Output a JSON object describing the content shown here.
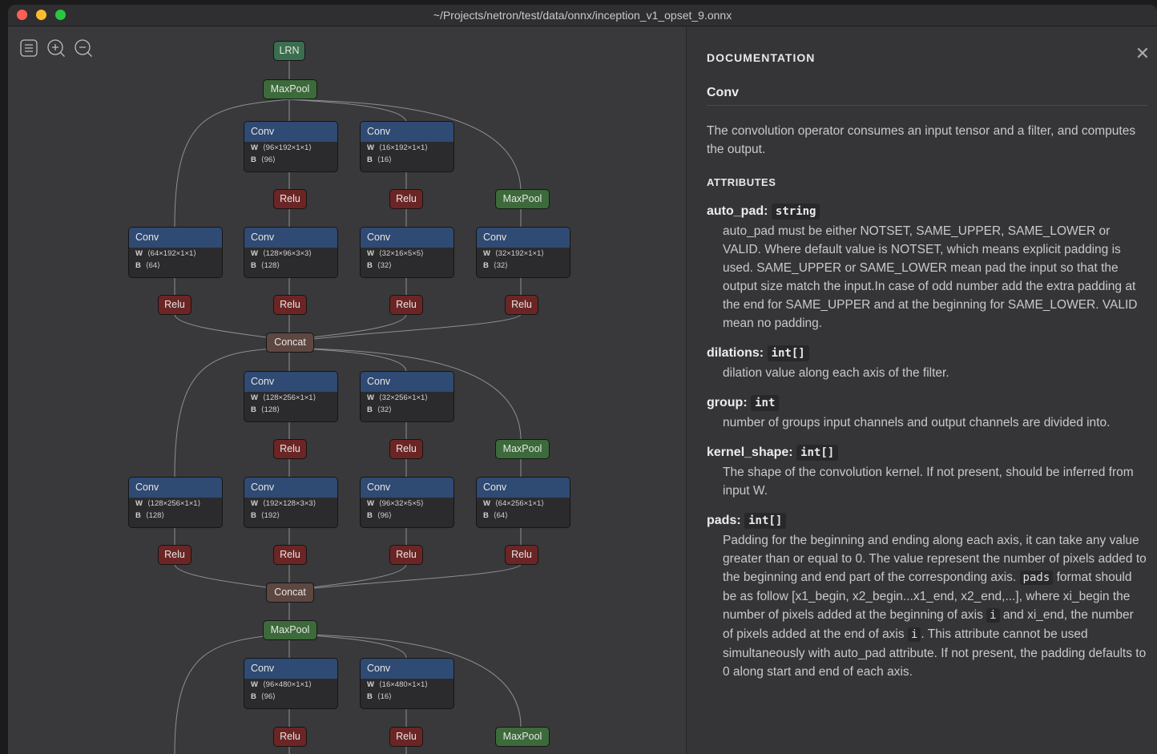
{
  "window": {
    "title": "~/Projects/netron/test/data/onnx/inception_v1_opset_9.onnx"
  },
  "toolbar": {
    "buttons": [
      "sidebar-icon",
      "zoom-in-icon",
      "zoom-out-icon"
    ]
  },
  "graph": {
    "ops": {
      "lrn": "LRN",
      "maxpool": "MaxPool",
      "conv": "Conv",
      "relu": "Relu",
      "concat": "Concat"
    },
    "convs": [
      {
        "w": "⟨96×192×1×1⟩",
        "b": "⟨96⟩"
      },
      {
        "w": "⟨16×192×1×1⟩",
        "b": "⟨16⟩"
      },
      {
        "w": "⟨64×192×1×1⟩",
        "b": "⟨64⟩"
      },
      {
        "w": "⟨128×96×3×3⟩",
        "b": "⟨128⟩"
      },
      {
        "w": "⟨32×16×5×5⟩",
        "b": "⟨32⟩"
      },
      {
        "w": "⟨32×192×1×1⟩",
        "b": "⟨32⟩"
      },
      {
        "w": "⟨128×256×1×1⟩",
        "b": "⟨128⟩"
      },
      {
        "w": "⟨32×256×1×1⟩",
        "b": "⟨32⟩"
      },
      {
        "w": "⟨128×256×1×1⟩",
        "b": "⟨128⟩"
      },
      {
        "w": "⟨192×128×3×3⟩",
        "b": "⟨192⟩"
      },
      {
        "w": "⟨96×32×5×5⟩",
        "b": "⟨96⟩"
      },
      {
        "w": "⟨64×256×1×1⟩",
        "b": "⟨64⟩"
      },
      {
        "w": "⟨96×480×1×1⟩",
        "b": "⟨96⟩"
      },
      {
        "w": "⟨16×480×1×1⟩",
        "b": "⟨16⟩"
      }
    ],
    "conv_labels": {
      "w": "W",
      "b": "B"
    }
  },
  "doc": {
    "title": "DOCUMENTATION",
    "close": "✕",
    "op_name": "Conv",
    "summary": "The convolution operator consumes an input tensor and a filter, and computes the output.",
    "attributes_heading": "ATTRIBUTES",
    "attributes": [
      {
        "name": "auto_pad:",
        "type": "string",
        "desc": "auto_pad must be either NOTSET, SAME_UPPER, SAME_LOWER or VALID. Where default value is NOTSET, which means explicit padding is used. SAME_UPPER or SAME_LOWER mean pad the input so that the output size match the input.In case of odd number add the extra padding at the end for SAME_UPPER and at the beginning for SAME_LOWER. VALID mean no padding."
      },
      {
        "name": "dilations:",
        "type": "int[]",
        "desc": "dilation value along each axis of the filter."
      },
      {
        "name": "group:",
        "type": "int",
        "desc": "number of groups input channels and output channels are divided into."
      },
      {
        "name": "kernel_shape:",
        "type": "int[]",
        "desc": "The shape of the convolution kernel. If not present, should be inferred from input W."
      },
      {
        "name": "pads:",
        "type": "int[]",
        "desc_1": "Padding for the beginning and ending along each axis, it can take any value greater than or equal to 0. The value represent the number of pixels added to the beginning and end part of the corresponding axis.",
        "code_pads": "pads",
        "desc_2": "format should be as follow [x1_begin, x2_begin...x1_end, x2_end,...], where xi_begin the number of pixels added at the beginning of axis",
        "code_i": "i",
        "desc_3": "and xi_end, the number of pixels added at the end of axis",
        "desc_4": ". This attribute cannot be used simultaneously with auto_pad attribute. If not present, the padding defaults to 0 along start and end of each axis."
      }
    ]
  }
}
